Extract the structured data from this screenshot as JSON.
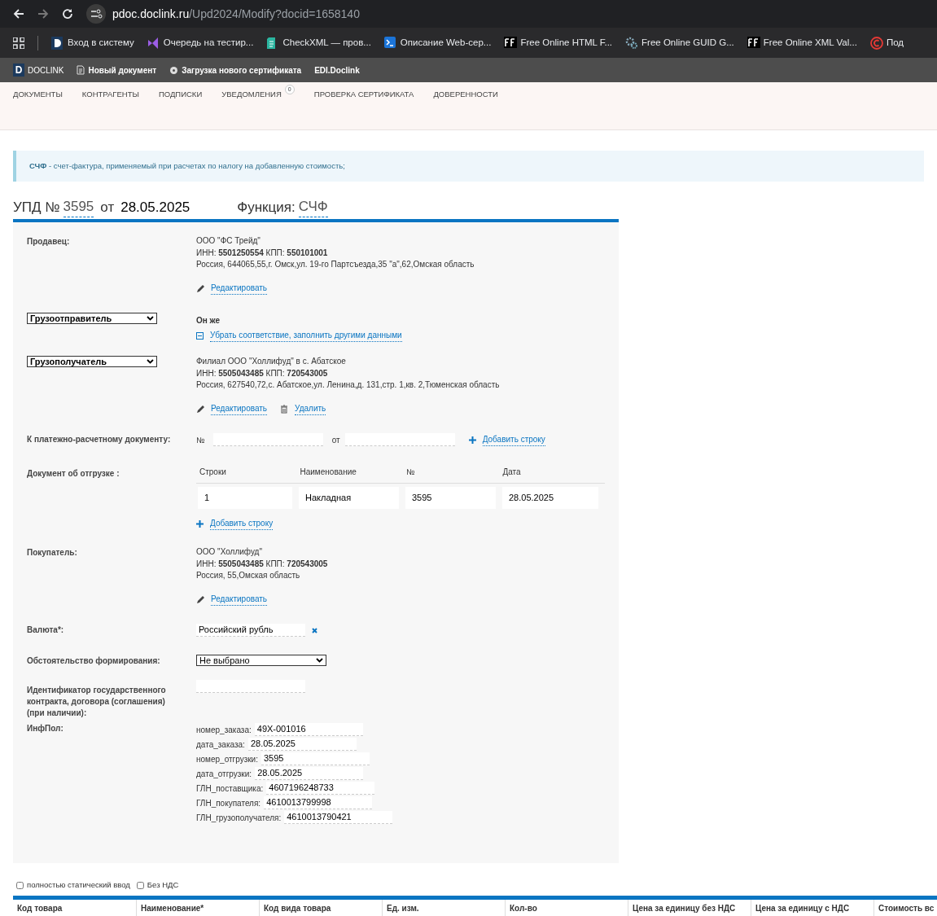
{
  "browser": {
    "url_host": "pdoc.doclink.ru",
    "url_path": "/Upd2024/Modify?docid=1658140",
    "bookmarks": [
      {
        "label": "Вход в систему"
      },
      {
        "label": "Очередь на тестир..."
      },
      {
        "label": "CheckXML — пров..."
      },
      {
        "label": "Описание Web-сер..."
      },
      {
        "label": "Free Online HTML F..."
      },
      {
        "label": "Free Online GUID G..."
      },
      {
        "label": "Free Online XML Val..."
      },
      {
        "label": "Под"
      }
    ]
  },
  "app_bar": {
    "brand_letter": "D",
    "brand": "DOCLINK",
    "items": [
      "Новый документ",
      "Загрузка нового сертификата",
      "EDI.Doclink"
    ]
  },
  "menu": [
    {
      "label": "ДОКУМЕНТЫ"
    },
    {
      "label": "КОНТРАГЕНТЫ"
    },
    {
      "label": "ПОДПИСКИ"
    },
    {
      "label": "УВЕДОМЛЕНИЯ",
      "badge": "0"
    },
    {
      "label": "ПРОВЕРКА СЕРТИФИКАТА"
    },
    {
      "label": "ДОВЕРЕННОСТИ"
    }
  ],
  "alert": "**СЧФ** - счет-фактура, применяемый при расчетах по налогу на добавленную стоимость;",
  "header": {
    "doc_label": "УПД №",
    "number": "3595",
    "from_label": "от",
    "date": "28.05.2025",
    "function_label": "Функция:",
    "function": "СЧФ"
  },
  "sections": [
    {
      "kind": "party",
      "label": "Продавец:",
      "name": "ООО \"ФС Трейд\"",
      "ids": "ИНН: **5501250554** КПП: **550101001**",
      "address": "Россия, 644065,55,г. Омск,ул. 19-го Партсъезда,35 \"а\",62,Омская область",
      "actions": [
        "Редактировать"
      ]
    },
    {
      "kind": "same",
      "select": "Грузоотправитель",
      "text": "Он же",
      "link": "Убрать соответствие, заполнить другими данными"
    },
    {
      "kind": "party",
      "select": "Грузополучатель",
      "name": "Филиал ООО \"Холлифуд\" в с. Абатское",
      "ids": "ИНН: **5505043485** КПП: **720543005**",
      "address": "Россия, 627540,72,с. Абатское,ул. Ленина,д. 131,стр. 1,кв. 2,Тюменская область",
      "actions": [
        "Редактировать",
        "Удалить"
      ]
    },
    {
      "kind": "payment",
      "label": "К платежно-расчетному документу:",
      "number_label": "№",
      "from_label": "от",
      "add": "Добавить строку"
    },
    {
      "kind": "shipment",
      "label": "Документ об отгрузке :",
      "columns": [
        "Строки",
        "Наименование",
        "№",
        "Дата"
      ],
      "rows": [
        [
          "1",
          "Накладная",
          "3595",
          "28.05.2025"
        ]
      ],
      "add": "Добавить строку"
    },
    {
      "kind": "party",
      "label": "Покупатель:",
      "name": "ООО \"Холлифуд\"",
      "ids": "ИНН: **5505043485** КПП: **720543005**",
      "address": "Россия, 55,Омская область",
      "actions": [
        "Редактировать"
      ]
    },
    {
      "kind": "currency",
      "label": "Валюта*:",
      "value": "Российский рубль"
    },
    {
      "kind": "select",
      "label": "Обстоятельство формирования:",
      "value": "Не выбрано"
    },
    {
      "kind": "text",
      "label": "Идентификатор государственного контракта, договора (соглашения) (при наличии):"
    },
    {
      "kind": "fields",
      "label": "ИнфПол:",
      "fields": [
        {
          "name": "номер_заказа:",
          "value": "49X-001016"
        },
        {
          "name": "дата_заказа:",
          "value": "28.05.2025"
        },
        {
          "name": "номер_отгрузки:",
          "value": "3595"
        },
        {
          "name": "дата_отгрузки:",
          "value": "28.05.2025"
        },
        {
          "name": "ГЛН_поставщика:",
          "value": "4607196248733"
        },
        {
          "name": "ГЛН_покупателя:",
          "value": "4610013799998"
        },
        {
          "name": "ГЛН_грузополучателя:",
          "value": "4610013790421"
        }
      ]
    }
  ],
  "options": [
    {
      "label": "полностью статический ввод",
      "checked": false
    },
    {
      "label": "Без НДС",
      "checked": false
    }
  ],
  "table": {
    "columns": [
      "Код товара",
      "Наименование*",
      "Код вида товара",
      "Ед. изм.",
      "Кол-во",
      "Цена за единицу без НДС",
      "Цена за единицу с НДС",
      "Стоимость вс"
    ]
  }
}
